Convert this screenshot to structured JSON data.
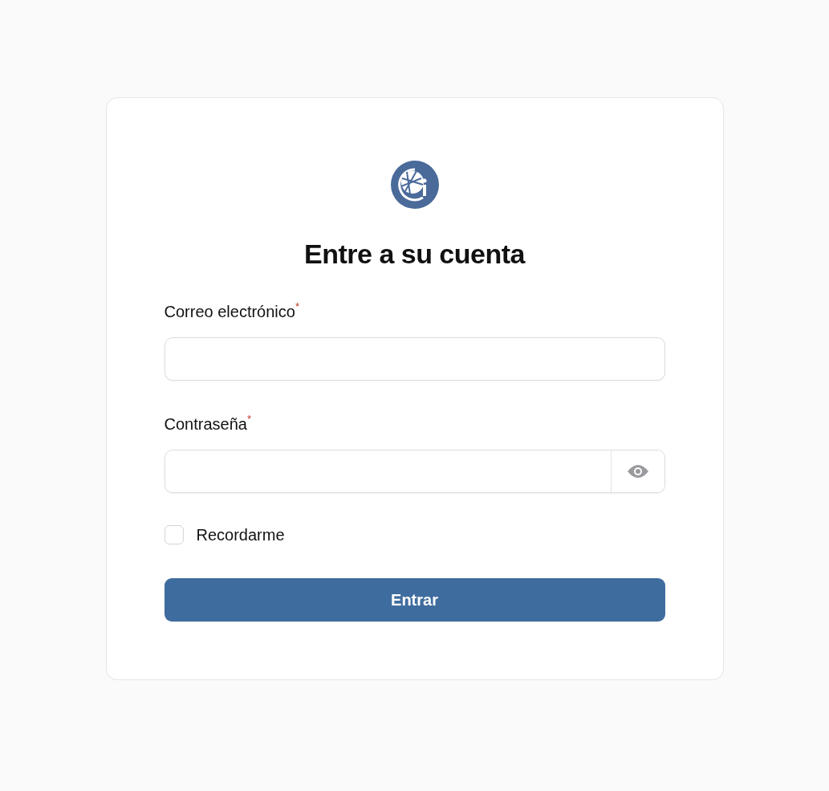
{
  "title": "Entre a su cuenta",
  "fields": [
    {
      "kind": "text",
      "label": "Correo electrónico",
      "required_mark": "*"
    },
    {
      "kind": "password",
      "label": "Contraseña",
      "required_mark": "*"
    }
  ],
  "remember": {
    "label": "Recordarme",
    "checked": false
  },
  "submit": {
    "label": "Entrar"
  }
}
